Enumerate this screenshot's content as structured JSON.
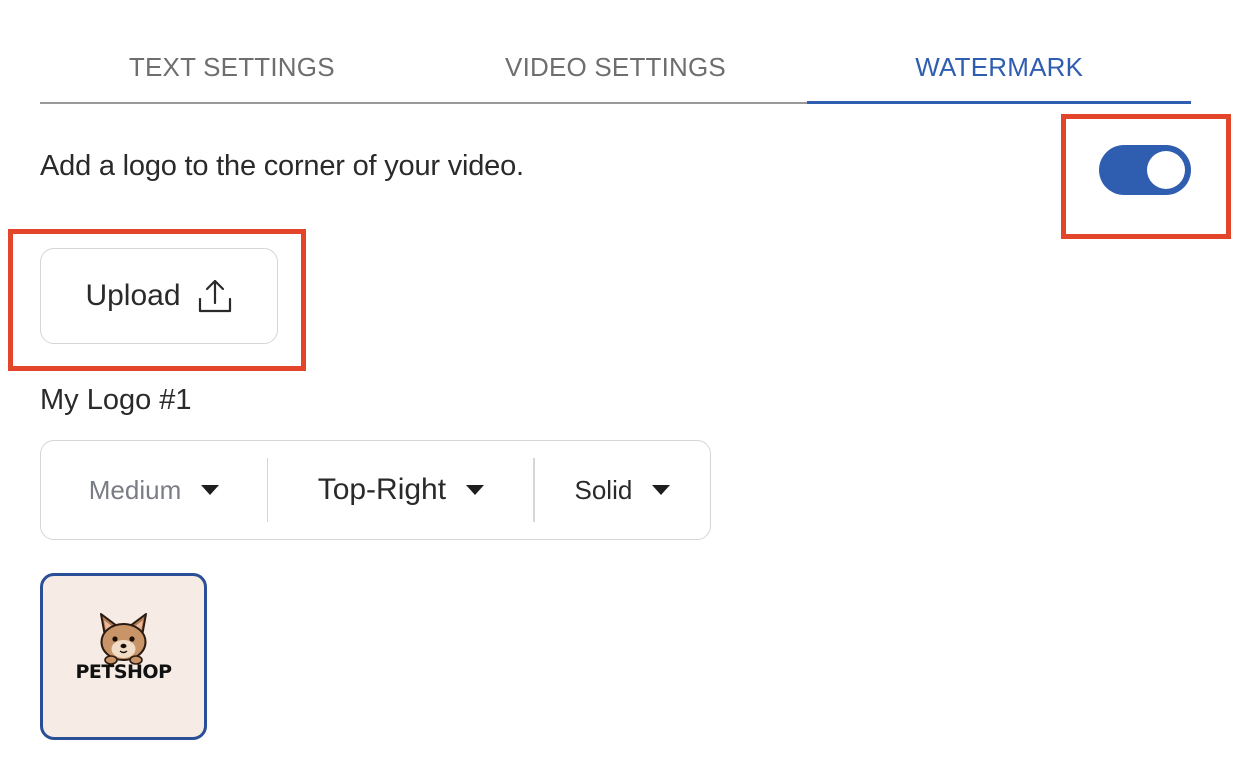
{
  "tabs": [
    {
      "label": "TEXT SETTINGS",
      "active": false
    },
    {
      "label": "VIDEO SETTINGS",
      "active": false
    },
    {
      "label": "WATERMARK",
      "active": true
    }
  ],
  "watermark": {
    "description": "Add a logo to the corner of your video.",
    "enabled": true,
    "upload_label": "Upload",
    "upload_icon": "upload-icon",
    "logo_name": "My Logo #1",
    "options": {
      "size": "Medium",
      "position": "Top-Right",
      "style": "Solid"
    },
    "thumbnail": {
      "text": "PETSHOP",
      "description_icon": "dog-icon"
    }
  },
  "colors": {
    "accent": "#2f5daf",
    "highlight": "#e3452b",
    "thumbnail_bg": "#f6ebe5"
  }
}
